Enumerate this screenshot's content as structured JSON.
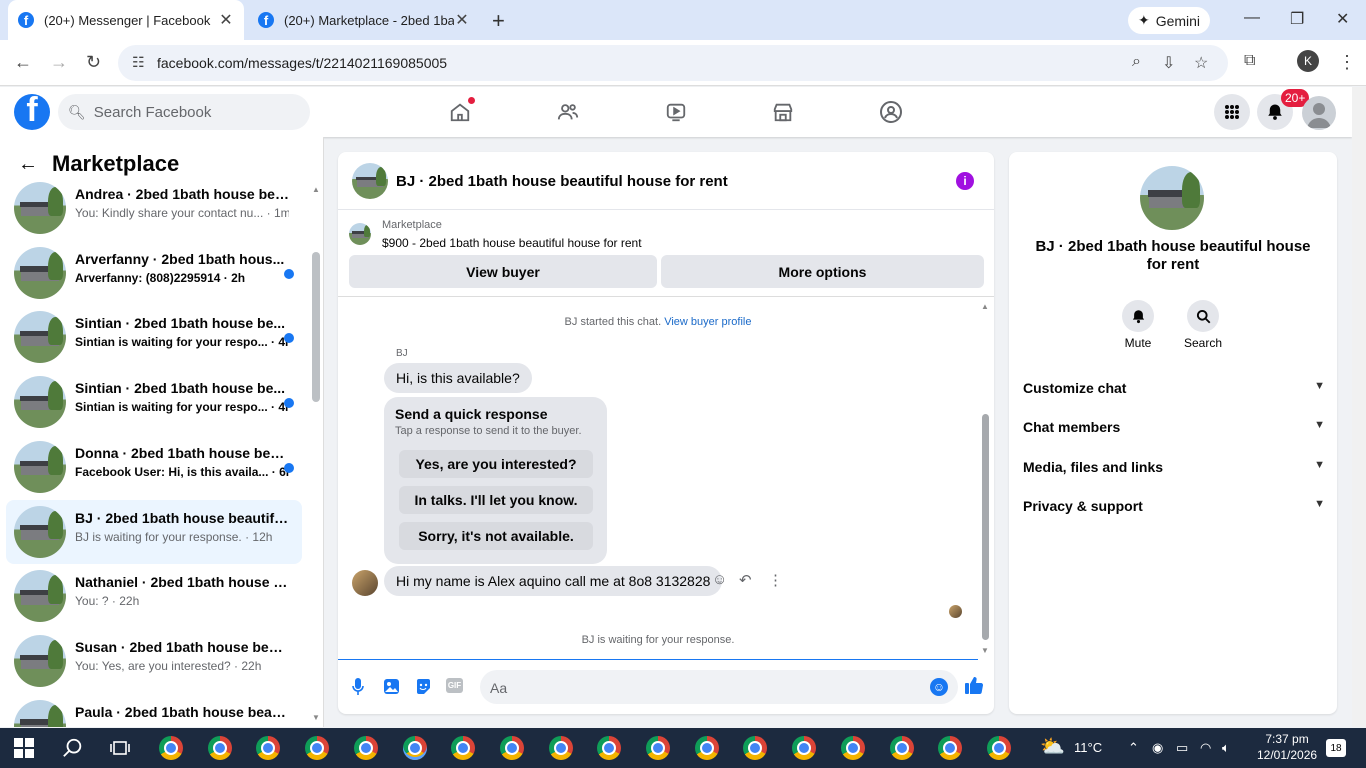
{
  "browser": {
    "tabs": [
      {
        "title": "(20+) Messenger | Facebook",
        "active": true
      },
      {
        "title": "(20+) Marketplace - 2bed 1bath",
        "active": false
      }
    ],
    "gemini_label": "Gemini",
    "url": "facebook.com/messages/t/2214021169085005",
    "profile_initial": "K"
  },
  "fb_header": {
    "search_placeholder": "Search Facebook",
    "notification_badge": "20+"
  },
  "left_panel": {
    "title": "Marketplace",
    "conversations": [
      {
        "name": "Andrea · 2bed 1bath house beau...",
        "preview": "You: Kindly share your contact nu... · 1m",
        "unread": false,
        "selected": false
      },
      {
        "name": "Arverfanny · 2bed 1bath hous...",
        "preview": "Arverfanny: (808)2295914 · 2h",
        "unread": true,
        "selected": false
      },
      {
        "name": "Sintian · 2bed 1bath house be...",
        "preview": "Sintian is waiting for your respo... · 4h",
        "unread": true,
        "selected": false
      },
      {
        "name": "Sintian · 2bed 1bath house be...",
        "preview": "Sintian is waiting for your respo... · 4h",
        "unread": true,
        "selected": false
      },
      {
        "name": "Donna · 2bed 1bath house bea...",
        "preview": "Facebook User: Hi, is this availa... · 6h",
        "unread": true,
        "selected": false
      },
      {
        "name": "BJ · 2bed 1bath house beautiful ...",
        "preview": "BJ is waiting for your response. · 12h",
        "unread": false,
        "selected": true
      },
      {
        "name": "Nathaniel · 2bed 1bath house b...",
        "preview": "You: ? · 22h",
        "unread": false,
        "selected": false
      },
      {
        "name": "Susan · 2bed 1bath house beaut...",
        "preview": "You: Yes, are you interested? · 22h",
        "unread": false,
        "selected": false
      },
      {
        "name": "Paula · 2bed 1bath house beauti...",
        "preview": "",
        "unread": false,
        "selected": false
      }
    ]
  },
  "chat": {
    "title": "BJ · 2bed 1bath house beautiful house for rent",
    "marketplace_label": "Marketplace",
    "listing": "$900 - 2bed 1bath house beautiful house for rent",
    "view_buyer": "View buyer",
    "more_options": "More options",
    "started_text": "BJ started this chat.",
    "view_profile_link": "View buyer profile",
    "sender_name": "BJ",
    "incoming_message": "Hi, is this available?",
    "quick_response": {
      "heading": "Send a quick response",
      "subtext": "Tap a response to send it to the buyer.",
      "options": [
        "Yes, are you interested?",
        "In talks. I'll let you know.",
        "Sorry, it's not available."
      ]
    },
    "message2": "Hi my name is Alex aquino call me at 8o8 3132828",
    "waiting_text": "BJ is waiting for your response.",
    "input_placeholder": "Aa"
  },
  "right_panel": {
    "title": "BJ · 2bed 1bath house beautiful house for rent",
    "mute_label": "Mute",
    "search_label": "Search",
    "sections": [
      "Customize chat",
      "Chat members",
      "Media, files and links",
      "Privacy & support"
    ]
  },
  "taskbar": {
    "weather": "11°C",
    "time": "7:37 pm",
    "date": "12/01/2026",
    "notifications": "18"
  }
}
